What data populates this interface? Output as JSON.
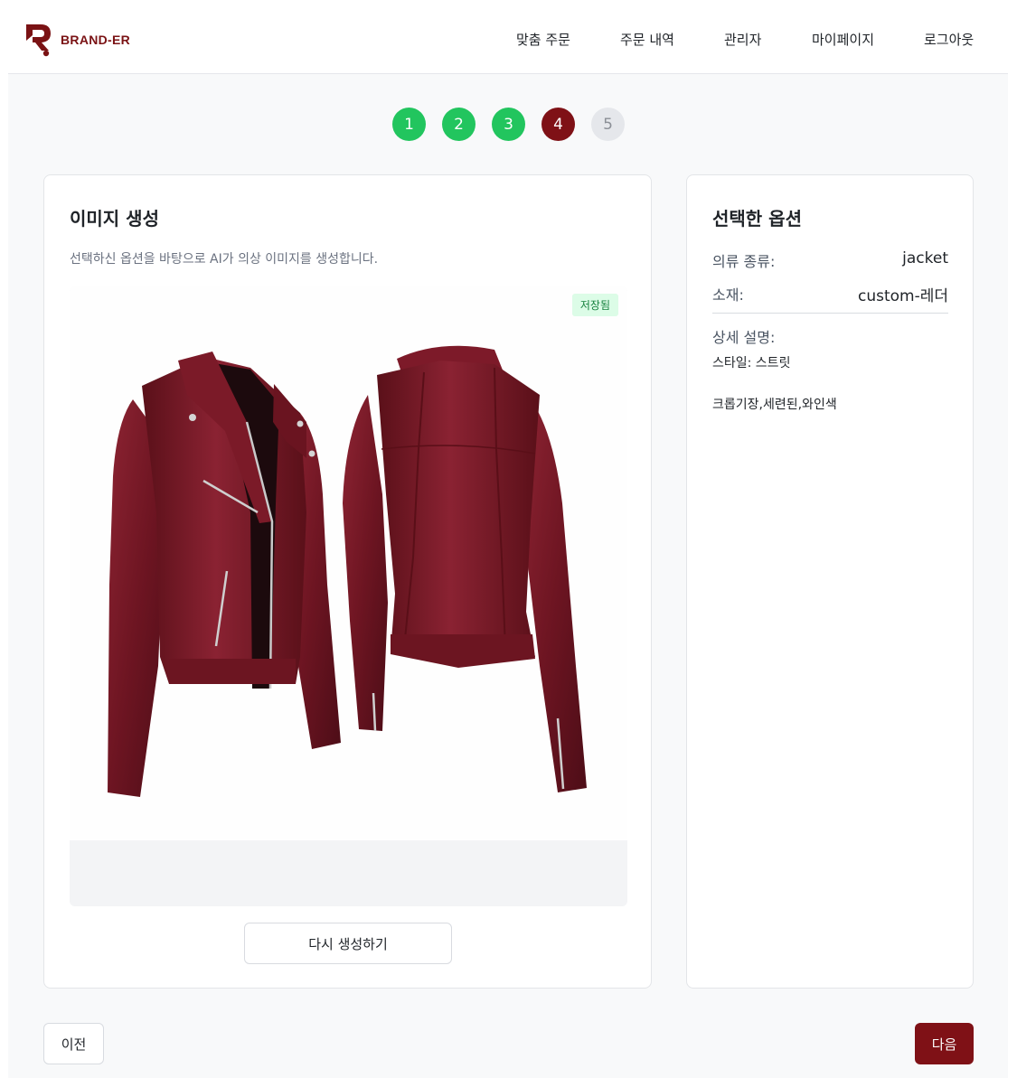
{
  "brand": {
    "name": "BRAND-ER",
    "color": "#7a1214"
  },
  "nav": {
    "items": [
      "맞춤 주문",
      "주문 내역",
      "관리자",
      "마이페이지",
      "로그아웃"
    ]
  },
  "stepper": {
    "steps": [
      "1",
      "2",
      "3",
      "4",
      "5"
    ],
    "current": 4,
    "colors": {
      "done": "#22c55e",
      "current": "#7f1116",
      "todo": "#e5e7eb"
    }
  },
  "image_card": {
    "title": "이미지 생성",
    "description": "선택하신 옵션을 바탕으로 AI가 의상 이미지를 생성합니다.",
    "badge": "저장됨",
    "regenerate_label": "다시 생성하기",
    "image_subject": "burgundy leather jacket, front and back views",
    "jacket_color": "#7a1a26"
  },
  "options_card": {
    "title": "선택한 옵션",
    "rows": [
      {
        "key": "의류 종류:",
        "value": "jacket"
      },
      {
        "key": "소재:",
        "value": "custom-레더"
      }
    ],
    "detail_label": "상세 설명:",
    "detail_lines": [
      "스타일: 스트릿",
      "크롭기장,세련된,와인색"
    ]
  },
  "footer": {
    "prev_label": "이전",
    "next_label": "다음"
  }
}
